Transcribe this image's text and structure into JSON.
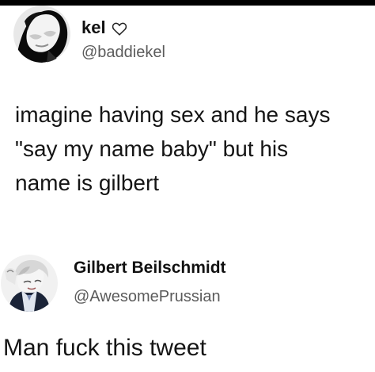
{
  "tweets": [
    {
      "display_name": "kel",
      "handle": "@baddiekel",
      "heart_icon": "heart-outline-icon",
      "text_lines": [
        "imagine having sex and he says",
        "\"say my name baby\" but his",
        "name is gilbert"
      ]
    },
    {
      "display_name": "Gilbert Beilschmidt",
      "handle": "@AwesomePrussian",
      "text": "Man fuck this tweet"
    }
  ]
}
